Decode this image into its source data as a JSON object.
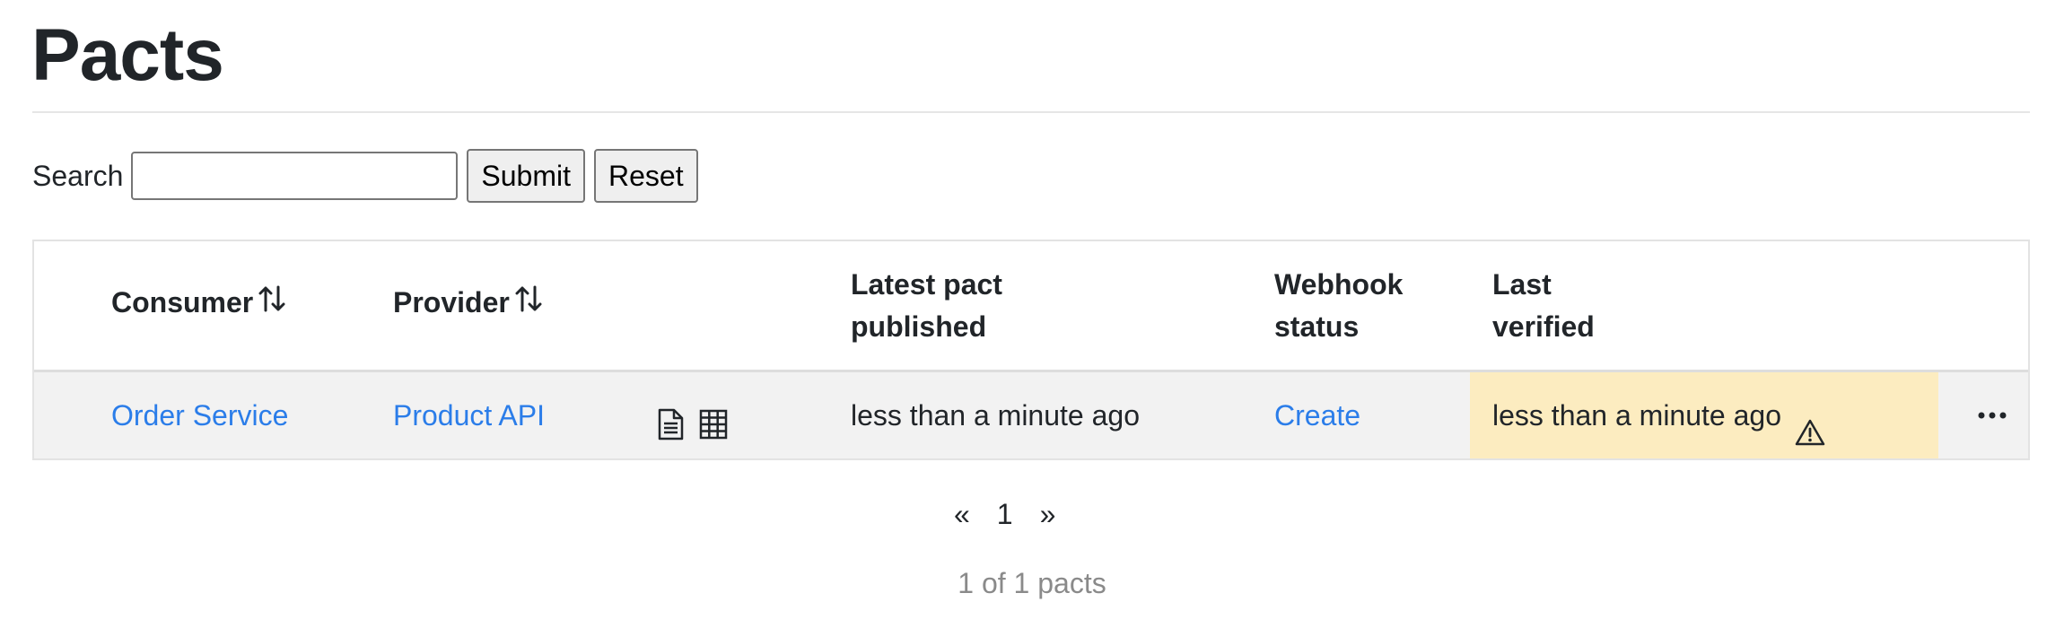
{
  "page": {
    "title": "Pacts"
  },
  "search": {
    "label": "Search",
    "value": "",
    "placeholder": "",
    "submit_label": "Submit",
    "reset_label": "Reset"
  },
  "table": {
    "headers": {
      "consumer": "Consumer",
      "provider": "Provider",
      "latest_pact_published_line1": "Latest pact",
      "latest_pact_published_line2": "published",
      "webhook_status_line1": "Webhook",
      "webhook_status_line2": "status",
      "last_verified_line1": "Last",
      "last_verified_line2": "verified"
    },
    "rows": [
      {
        "consumer": "Order Service",
        "provider": "Product API",
        "icons": [
          "document-icon",
          "table-grid-icon"
        ],
        "latest_pact_published": "less than a minute ago",
        "webhook_status": "Create",
        "last_verified": "less than a minute ago",
        "last_verified_status": "warning",
        "actions_icon": "ellipsis-icon"
      }
    ]
  },
  "pagination": {
    "prev": "«",
    "current": "1",
    "next": "»"
  },
  "summary": {
    "count_text": "1 of 1 pacts"
  },
  "colors": {
    "link": "#2b7de9",
    "warning_background": "#fcecc0",
    "row_background": "#f2f2f2",
    "muted_text": "#8a8a8a"
  }
}
